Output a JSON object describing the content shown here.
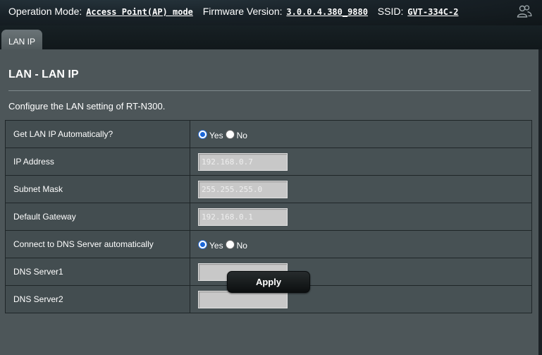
{
  "header": {
    "operation_mode_label": "Operation Mode:",
    "operation_mode_value": "Access Point(AP) mode",
    "firmware_label": "Firmware Version:",
    "firmware_value": "3.0.0.4.380_9880",
    "ssid_label": "SSID:",
    "ssid_value": "GVT-334C-2",
    "user_icon": "users-icon"
  },
  "tabs": [
    {
      "label": "LAN IP",
      "active": true
    }
  ],
  "panel": {
    "title": "LAN - LAN IP",
    "description": "Configure the LAN setting of RT-N300."
  },
  "form": {
    "get_lan_ip_auto": {
      "label": "Get LAN IP Automatically?",
      "yes": "Yes",
      "no": "No",
      "selected": "Yes"
    },
    "ip_address": {
      "label": "IP Address",
      "value": "192.168.0.7"
    },
    "subnet_mask": {
      "label": "Subnet Mask",
      "value": "255.255.255.0"
    },
    "default_gateway": {
      "label": "Default Gateway",
      "value": "192.168.0.1"
    },
    "dns_auto": {
      "label": "Connect to DNS Server automatically",
      "yes": "Yes",
      "no": "No",
      "selected": "Yes"
    },
    "dns_server1": {
      "label": "DNS Server1",
      "value": ""
    },
    "dns_server2": {
      "label": "DNS Server2",
      "value": ""
    }
  },
  "apply_label": "Apply",
  "colors": {
    "panel_bg": "#4d5659",
    "label_cell_bg": "#434d50",
    "value_cell_bg": "#475154",
    "radio_accent": "#1a66d9"
  }
}
